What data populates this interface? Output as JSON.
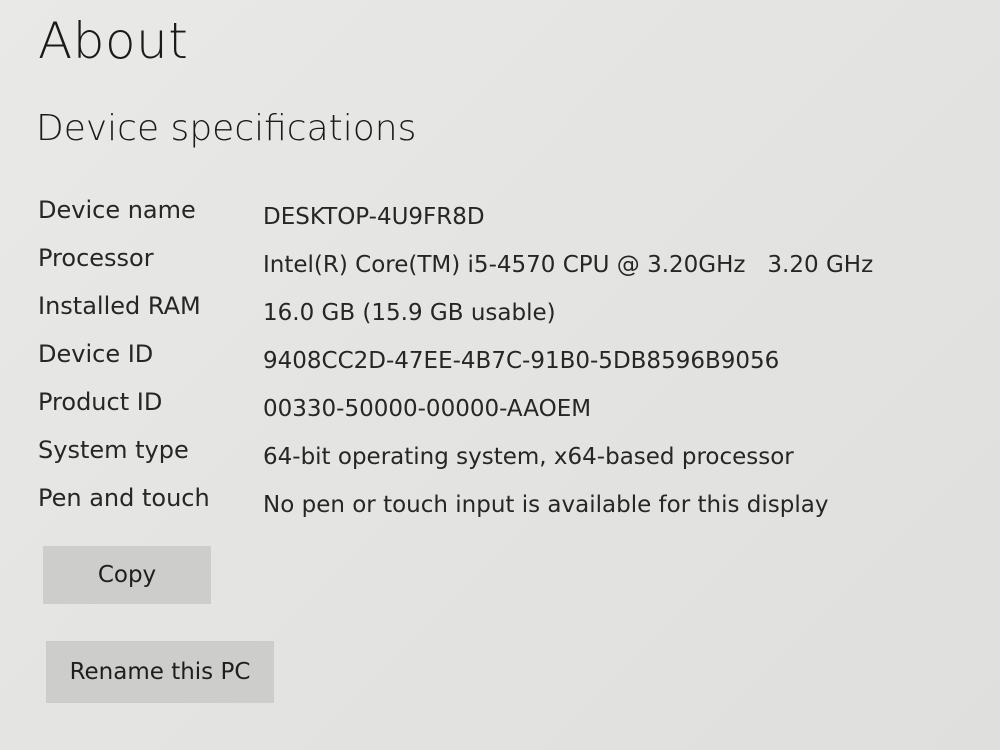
{
  "header": {
    "title": "About"
  },
  "section": {
    "title": "Device specifications"
  },
  "specs": [
    {
      "label": "Device name",
      "value": "DESKTOP-4U9FR8D"
    },
    {
      "label": "Processor",
      "value": "Intel(R) Core(TM) i5-4570 CPU @ 3.20GHz   3.20 GHz"
    },
    {
      "label": "Installed RAM",
      "value": "16.0 GB (15.9 GB usable)"
    },
    {
      "label": "Device ID",
      "value": "9408CC2D-47EE-4B7C-91B0-5DB8596B9056"
    },
    {
      "label": "Product ID",
      "value": "00330-50000-00000-AAOEM"
    },
    {
      "label": "System type",
      "value": "64-bit operating system, x64-based processor"
    },
    {
      "label": "Pen and touch",
      "value": "No pen or touch input is available for this display"
    }
  ],
  "actions": {
    "copy_label": "Copy",
    "rename_label": "Rename this PC"
  }
}
